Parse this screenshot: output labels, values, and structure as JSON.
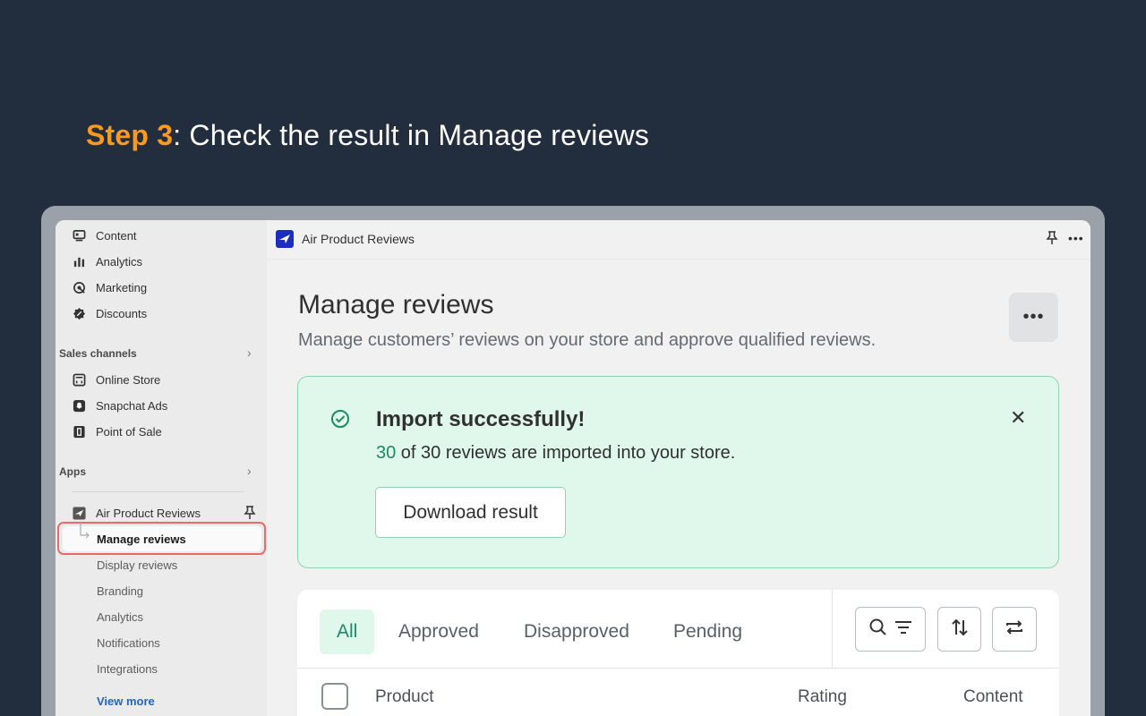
{
  "heading": {
    "step": "Step 3",
    "rest": ": Check the result in Manage reviews"
  },
  "sidebar": {
    "top_items": [
      {
        "label": "Content",
        "icon": "content-icon"
      },
      {
        "label": "Analytics",
        "icon": "analytics-icon"
      },
      {
        "label": "Marketing",
        "icon": "marketing-icon"
      },
      {
        "label": "Discounts",
        "icon": "discounts-icon"
      }
    ],
    "sales_channels": {
      "title": "Sales channels",
      "items": [
        {
          "label": "Online Store",
          "icon": "store-icon"
        },
        {
          "label": "Snapchat Ads",
          "icon": "snapchat-icon"
        },
        {
          "label": "Point of Sale",
          "icon": "pos-icon"
        }
      ]
    },
    "apps": {
      "title": "Apps",
      "app_name": "Air Product Reviews",
      "sub_items": [
        "Manage reviews",
        "Display reviews",
        "Branding",
        "Analytics",
        "Notifications",
        "Integrations"
      ],
      "view_more": "View more"
    }
  },
  "topbar": {
    "app_title": "Air Product Reviews"
  },
  "main": {
    "title": "Manage reviews",
    "subtitle": "Manage customers’ reviews on your store and approve qualified reviews.",
    "banner": {
      "title": "Import successfully!",
      "count": "30",
      "message_rest": " of 30 reviews are imported into your store.",
      "button": "Download result"
    },
    "tabs": [
      "All",
      "Approved",
      "Disapproved",
      "Pending"
    ],
    "columns": [
      "Product",
      "Rating",
      "Content"
    ]
  },
  "colors": {
    "accent": "#f79a1e",
    "success": "#1c8a64",
    "banner_bg": "#e0f7ec",
    "link": "#2463c8"
  }
}
